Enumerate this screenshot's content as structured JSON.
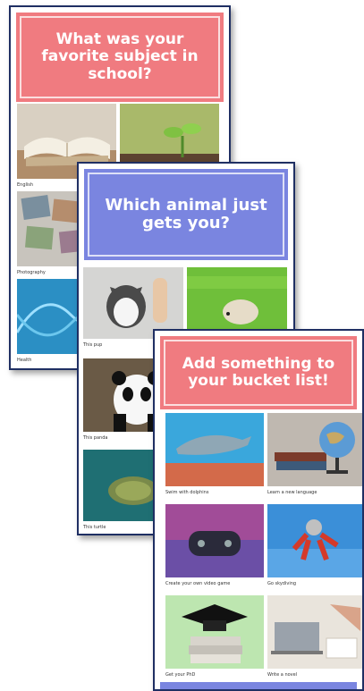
{
  "cards": {
    "school": {
      "title": "What was your favorite subject in school?",
      "options": [
        "English",
        "",
        "Photography",
        "",
        "Health",
        ""
      ]
    },
    "animal": {
      "title": "Which animal just gets you?",
      "options": [
        "This pup",
        "",
        "This panda",
        "",
        "This turtle",
        ""
      ]
    },
    "bucket": {
      "title": "Add something to your bucket list!",
      "options": [
        "Swim with dolphins",
        "Learn a new language",
        "Create your own video game",
        "Go skydiving",
        "Get your PhD",
        "Write a novel"
      ]
    }
  },
  "colors": {
    "pink": "#f07b80",
    "blue": "#7a85e0",
    "border": "#1f2f63"
  }
}
